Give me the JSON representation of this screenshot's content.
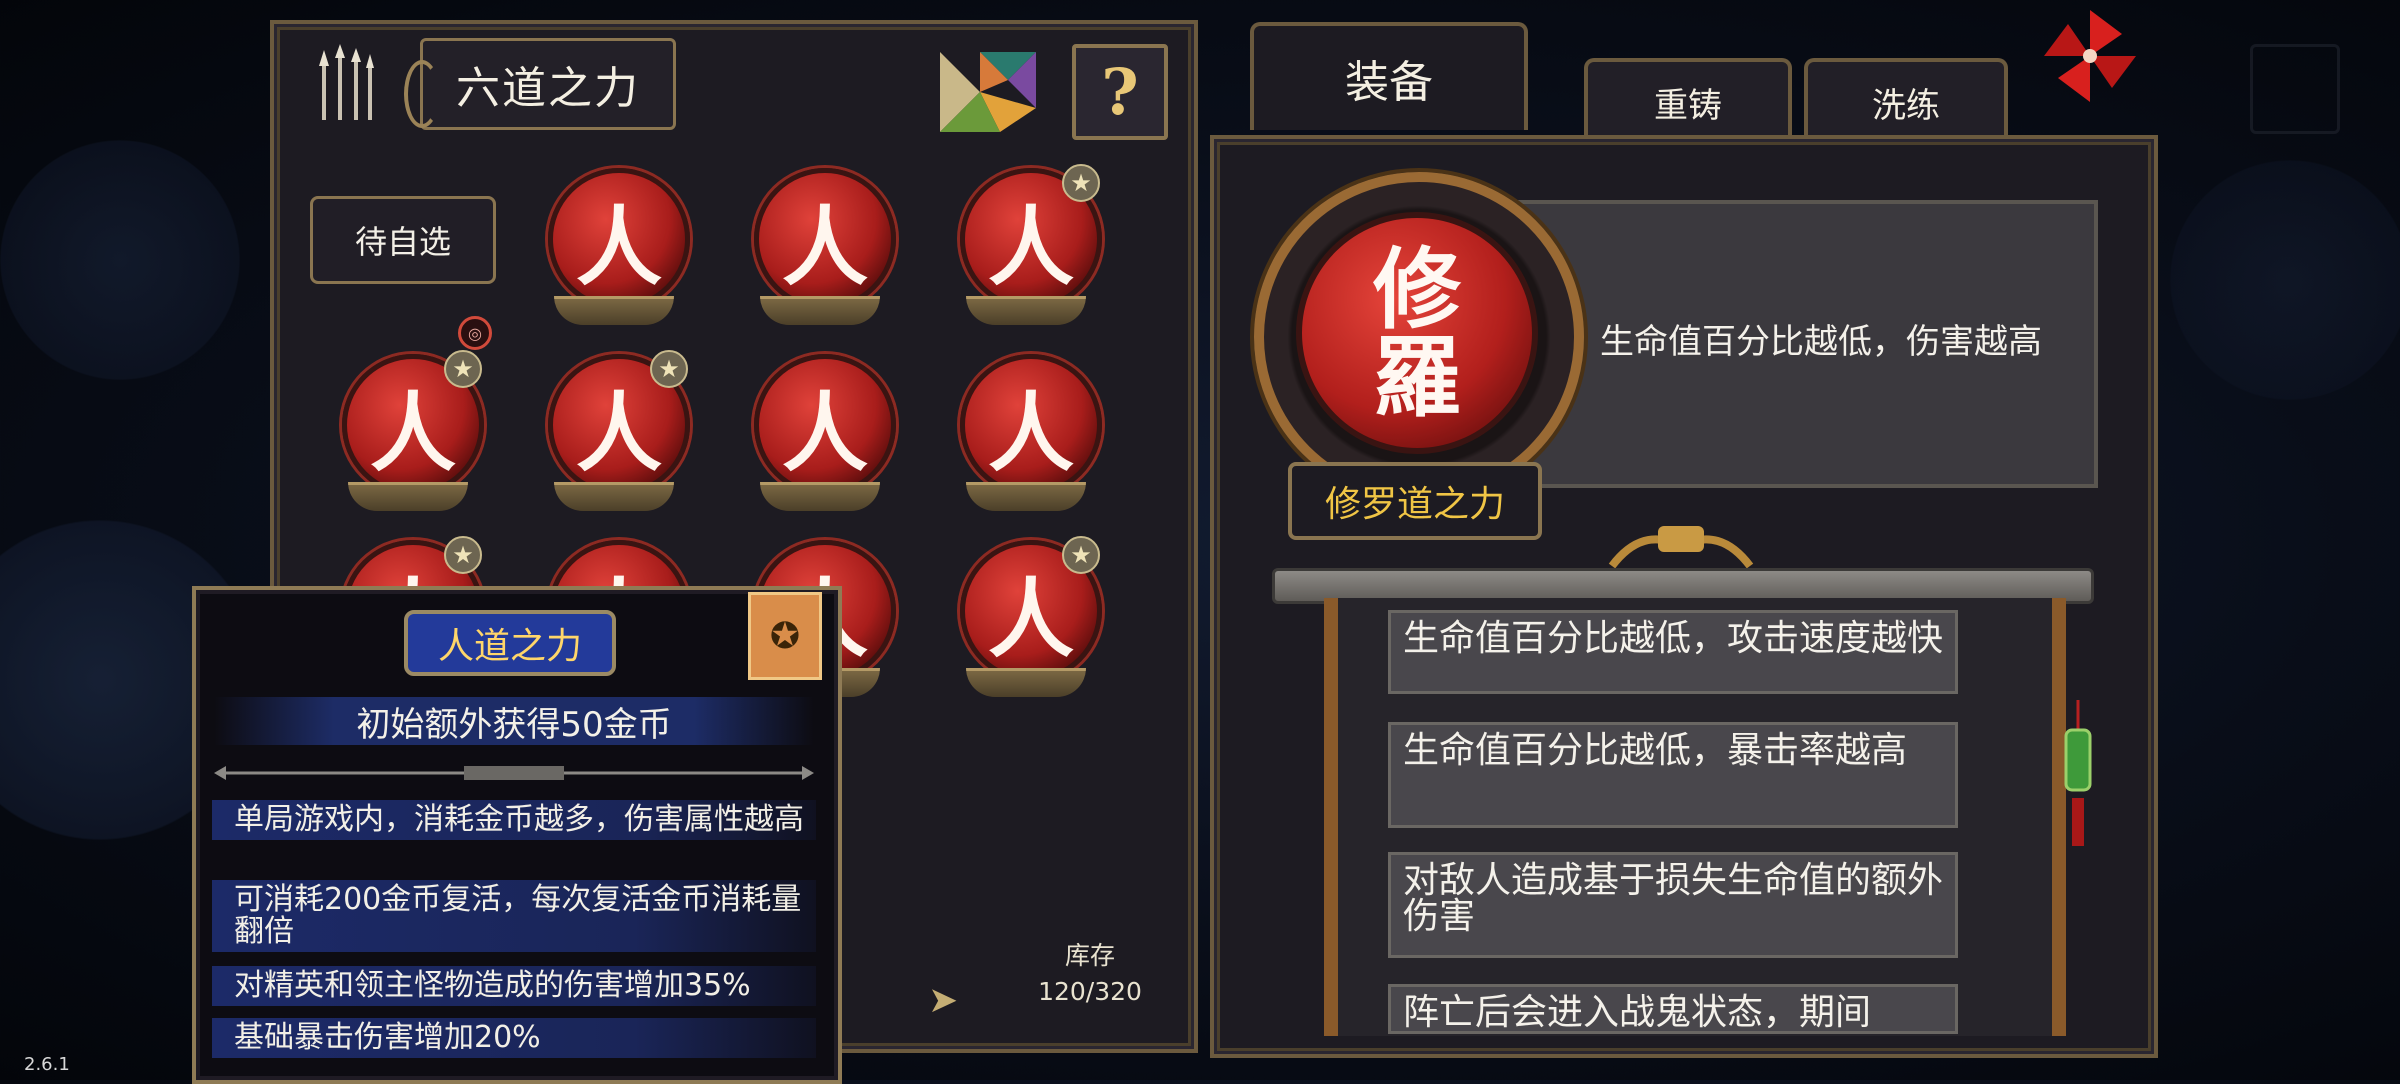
{
  "version": "2.6.1",
  "left_panel": {
    "title": "六道之力",
    "help_label": "?",
    "pending_label": "待自选",
    "small_badge": "◎",
    "orb_glyph": "人",
    "orbs": [
      {
        "row": 0,
        "col": 1,
        "starred": false
      },
      {
        "row": 0,
        "col": 2,
        "starred": false
      },
      {
        "row": 0,
        "col": 3,
        "starred": true
      },
      {
        "row": 1,
        "col": 0,
        "starred": true
      },
      {
        "row": 1,
        "col": 1,
        "starred": true
      },
      {
        "row": 1,
        "col": 2,
        "starred": false
      },
      {
        "row": 1,
        "col": 3,
        "starred": false
      },
      {
        "row": 2,
        "col": 0,
        "starred": true
      },
      {
        "row": 2,
        "col": 1,
        "starred": false
      },
      {
        "row": 2,
        "col": 2,
        "starred": false
      },
      {
        "row": 2,
        "col": 3,
        "starred": true
      }
    ],
    "inventory_label": "库存",
    "inventory_value": "120/320"
  },
  "tooltip": {
    "title": "人道之力",
    "badge_icon": "star-badge-icon",
    "main_effect": "初始额外获得50金币",
    "lines": [
      "单局游戏内，消耗金币越多，伤害属性越高",
      "可消耗200金币复活，每次复活金币消耗量翻倍",
      "对精英和领主怪物造成的伤害增加35%",
      "基础暴击伤害增加20%"
    ]
  },
  "right_panel": {
    "tabs": {
      "equip": "装备",
      "recast": "重铸",
      "refine": "洗练"
    },
    "selected_glyph_top": "修",
    "selected_glyph_bottom": "羅",
    "selected_name": "修罗道之力",
    "selected_description": "生命值百分比越低，伤害越高",
    "effects": [
      "生命值百分比越低，攻击速度越快",
      "生命值百分比越低，暴击率越高",
      "对敌人造成基于损失生命值的额外伤害",
      "阵亡后会进入战鬼状态，期间"
    ]
  },
  "colors": {
    "gold_text": "#f0c545",
    "orb_red": "#b21f1c",
    "frame": "#8a7550",
    "tooltip_blue": "#1c2a68"
  }
}
